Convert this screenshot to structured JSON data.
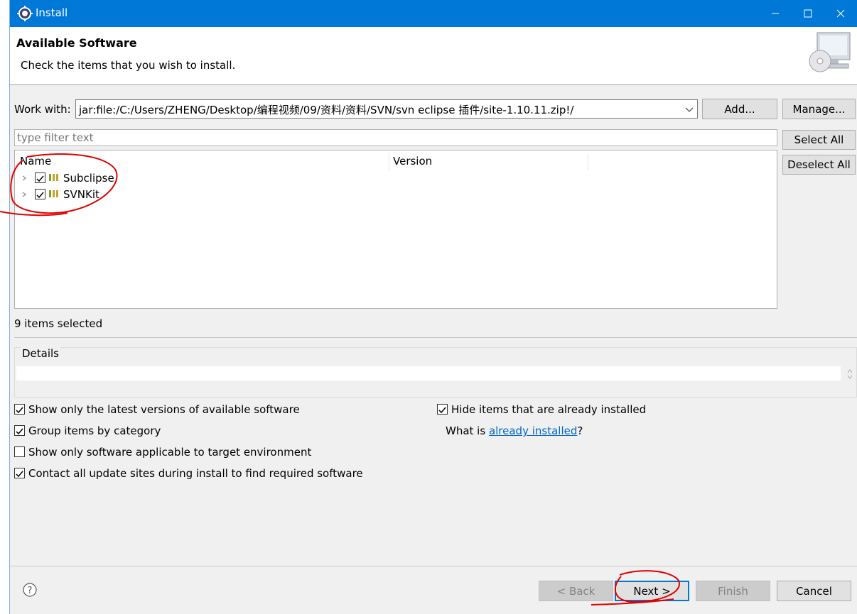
{
  "window": {
    "title": "Install"
  },
  "banner": {
    "heading": "Available Software",
    "description": "Check the items that you wish to install."
  },
  "work_with": {
    "label": "Work with:",
    "value": "jar:file:/C:/Users/ZHENG/Desktop/编程视频/09/资料/资料/SVN/svn eclipse 插件/site-1.10.11.zip!/",
    "add_label": "Add...",
    "manage_label": "Manage..."
  },
  "filter": {
    "placeholder": "type filter text"
  },
  "tree": {
    "columns": [
      "Name",
      "Version"
    ],
    "items": [
      {
        "label": "Subclipse",
        "checked": true
      },
      {
        "label": "SVNKit",
        "checked": true
      }
    ]
  },
  "side_buttons": {
    "select_all": "Select All",
    "deselect_all": "Deselect All"
  },
  "selection_status": "9 items selected",
  "details": {
    "label": "Details"
  },
  "options": {
    "latest_versions": "Show only the latest versions of available software",
    "group_by_category": "Group items by category",
    "applicable_only": "Show only software applicable to target environment",
    "contact_all_sites": "Contact all update sites during install to find required software",
    "hide_installed": "Hide items that are already installed",
    "what_is_prefix": "What is ",
    "what_is_link": "already installed",
    "what_is_suffix": "?"
  },
  "footer": {
    "back": "< Back",
    "next": "Next >",
    "finish": "Finish",
    "cancel": "Cancel"
  },
  "colors": {
    "titlebar": "#0078d7",
    "link": "#0066cc",
    "annotation": "#e00000"
  }
}
